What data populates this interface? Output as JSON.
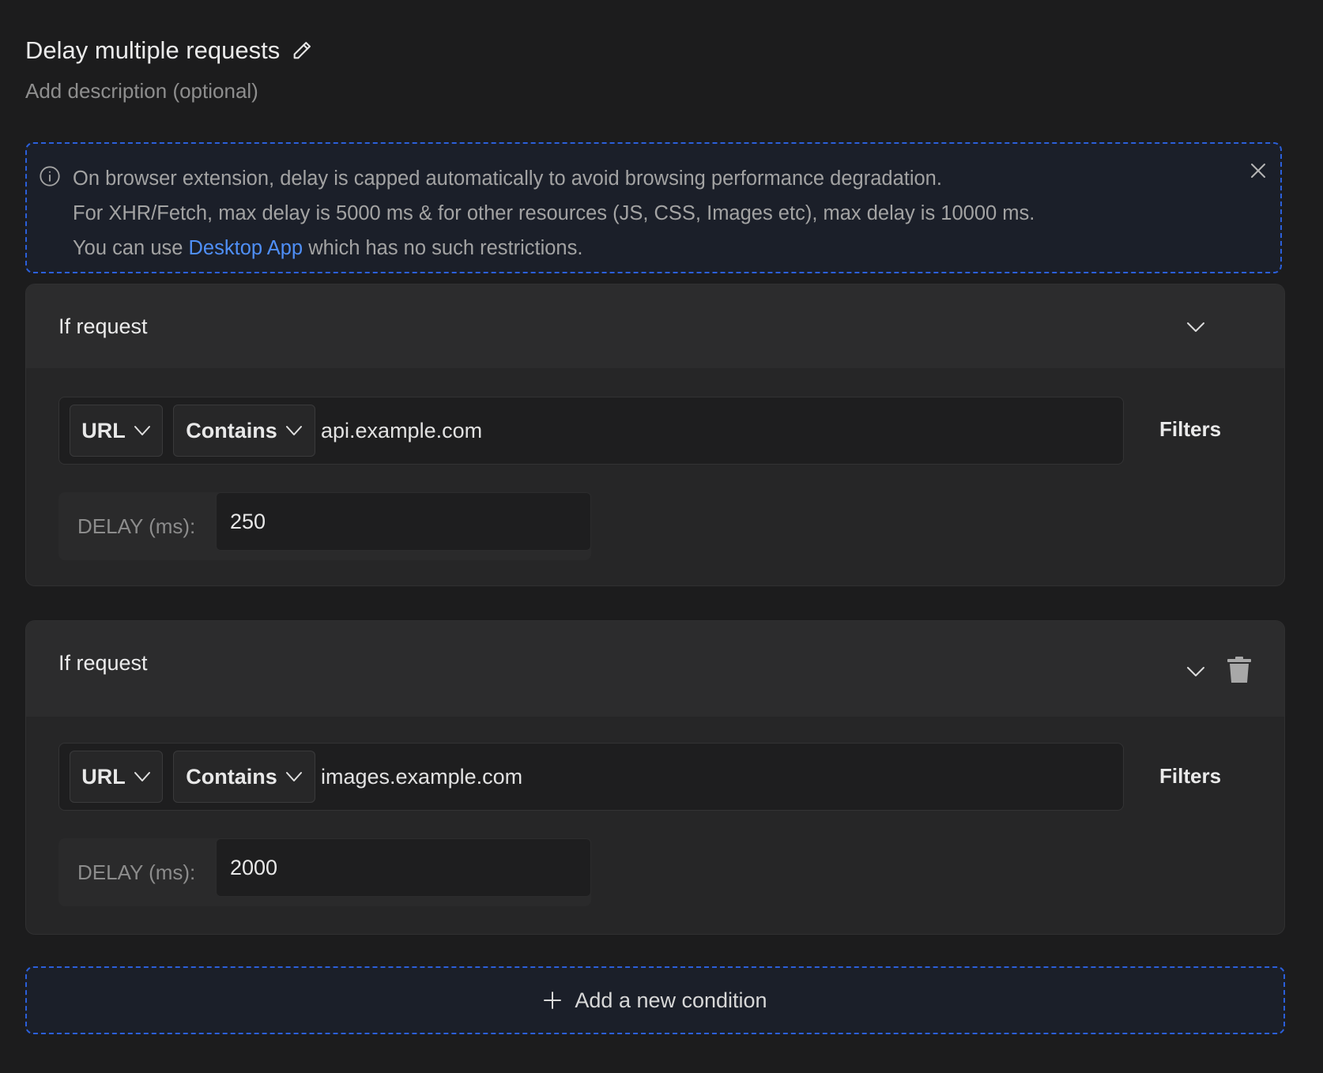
{
  "rule": {
    "title": "Delay multiple requests",
    "description_placeholder": "Add description (optional)"
  },
  "banner": {
    "line1": "On browser extension, delay is capped automatically to avoid browsing performance degradation.",
    "line2": "For XHR/Fetch, max delay is 5000 ms & for other resources (JS, CSS, Images etc), max delay is 10000 ms.",
    "line3_prefix": "You can use ",
    "line3_link": "Desktop App",
    "line3_suffix": " which has no such restrictions."
  },
  "conditions": [
    {
      "header": "If request",
      "source_key": "URL",
      "operator": "Contains",
      "value": "api.example.com",
      "filters_label": "Filters",
      "delay_label": "DELAY (ms):",
      "delay_value": "250"
    },
    {
      "header": "If request",
      "source_key": "URL",
      "operator": "Contains",
      "value": "images.example.com",
      "filters_label": "Filters",
      "delay_label": "DELAY (ms):",
      "delay_value": "2000"
    }
  ],
  "add_condition_label": "Add a new condition",
  "colors": {
    "background": "#1c1c1d",
    "accent_dashed_border": "#2b5fd9",
    "link": "#4f8ff7",
    "card": "#262627"
  },
  "icons": [
    "edit-icon",
    "info-icon",
    "close-icon",
    "chevron-down-icon",
    "trash-icon",
    "plus-icon"
  ]
}
